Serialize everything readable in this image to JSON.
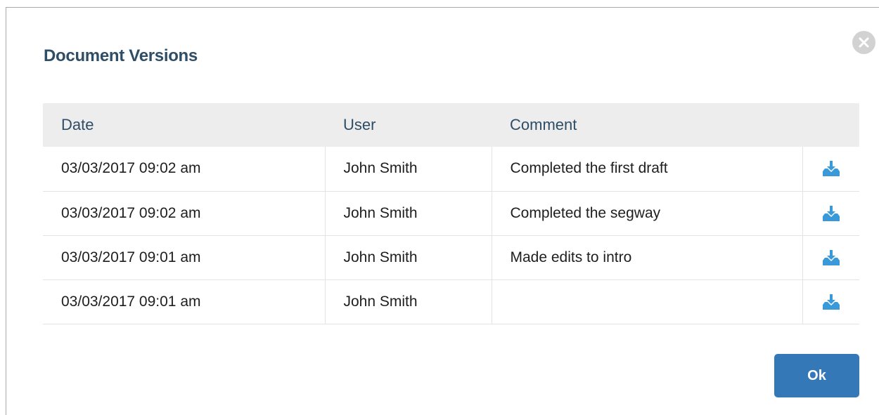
{
  "dialog": {
    "title": "Document Versions",
    "close_icon": "close-circle-icon",
    "ok_label": "Ok"
  },
  "table": {
    "columns": [
      "Date",
      "User",
      "Comment",
      ""
    ],
    "rows": [
      {
        "date": "03/03/2017 09:02 am",
        "user": "John Smith",
        "comment": "Completed the first draft",
        "action_icon": "download-icon"
      },
      {
        "date": "03/03/2017 09:02 am",
        "user": "John Smith",
        "comment": "Completed the segway",
        "action_icon": "download-icon"
      },
      {
        "date": "03/03/2017 09:01 am",
        "user": "John Smith",
        "comment": "Made edits to intro",
        "action_icon": "download-icon"
      },
      {
        "date": "03/03/2017 09:01 am",
        "user": "John Smith",
        "comment": "",
        "action_icon": "download-icon"
      }
    ]
  },
  "colors": {
    "title": "#2e4d66",
    "header_bg": "#ededed",
    "accent": "#3478b7",
    "download_icon": "#3a9ad9",
    "close_button": "#d2d2d2"
  }
}
